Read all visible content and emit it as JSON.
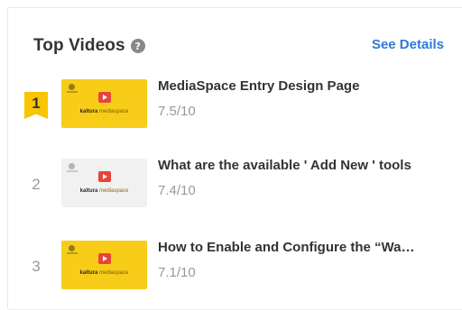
{
  "widget": {
    "title": "Top Videos",
    "help_icon": "help-icon",
    "help_glyph": "?",
    "see_details_label": "See Details",
    "accent_color": "#2f7ad6",
    "rank_highlight_color": "#f7c600"
  },
  "videos": [
    {
      "rank": "1",
      "title": "MediaSpace Entry Design Page",
      "score": "7.5/10",
      "brand_bold": "kaltura",
      "brand_rest": " mediaspace"
    },
    {
      "rank": "2",
      "title": "What are the available ' Add New ' tools",
      "score": "7.4/10",
      "brand_bold": "kaltura",
      "brand_rest": " mediaspace"
    },
    {
      "rank": "3",
      "title": "How to Enable and Configure the “Wa…",
      "score": "7.1/10",
      "brand_bold": "kaltura",
      "brand_rest": " mediaspace"
    }
  ]
}
